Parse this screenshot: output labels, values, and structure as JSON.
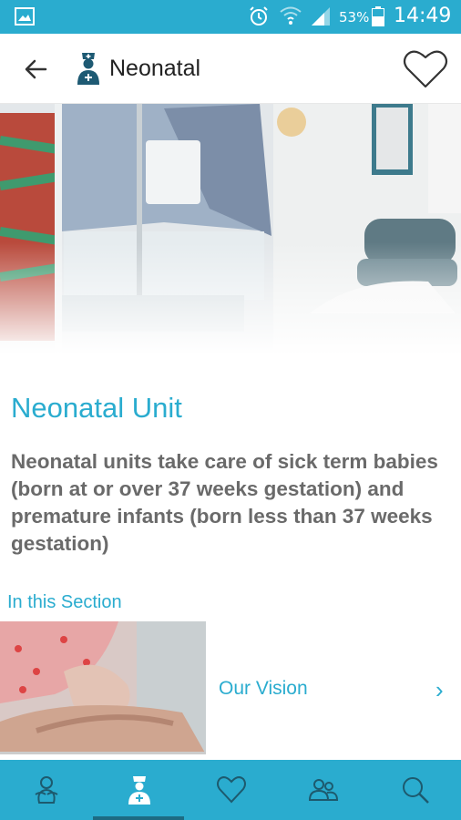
{
  "status_bar": {
    "battery_percent": "53%",
    "time": "14:49"
  },
  "app_bar": {
    "title": "Neonatal"
  },
  "content": {
    "heading": "Neonatal Unit",
    "intro": "Neonatal units take care of sick term babies (born at or over 37 weeks gestation) and premature infants (born less than 37 weeks gestation)",
    "section_label": "In this Section",
    "items": [
      {
        "label": "Our Vision",
        "chevron": "›"
      }
    ]
  },
  "bottom_nav": {
    "items": [
      {
        "icon": "baby-icon",
        "active": false
      },
      {
        "icon": "nurse-icon",
        "active": true
      },
      {
        "icon": "heart-icon",
        "active": false
      },
      {
        "icon": "people-icon",
        "active": false
      },
      {
        "icon": "search-icon",
        "active": false
      }
    ]
  },
  "colors": {
    "accent": "#2aaccf",
    "nav_indicator": "#1d6b83",
    "body_text": "#6a6a6a"
  }
}
